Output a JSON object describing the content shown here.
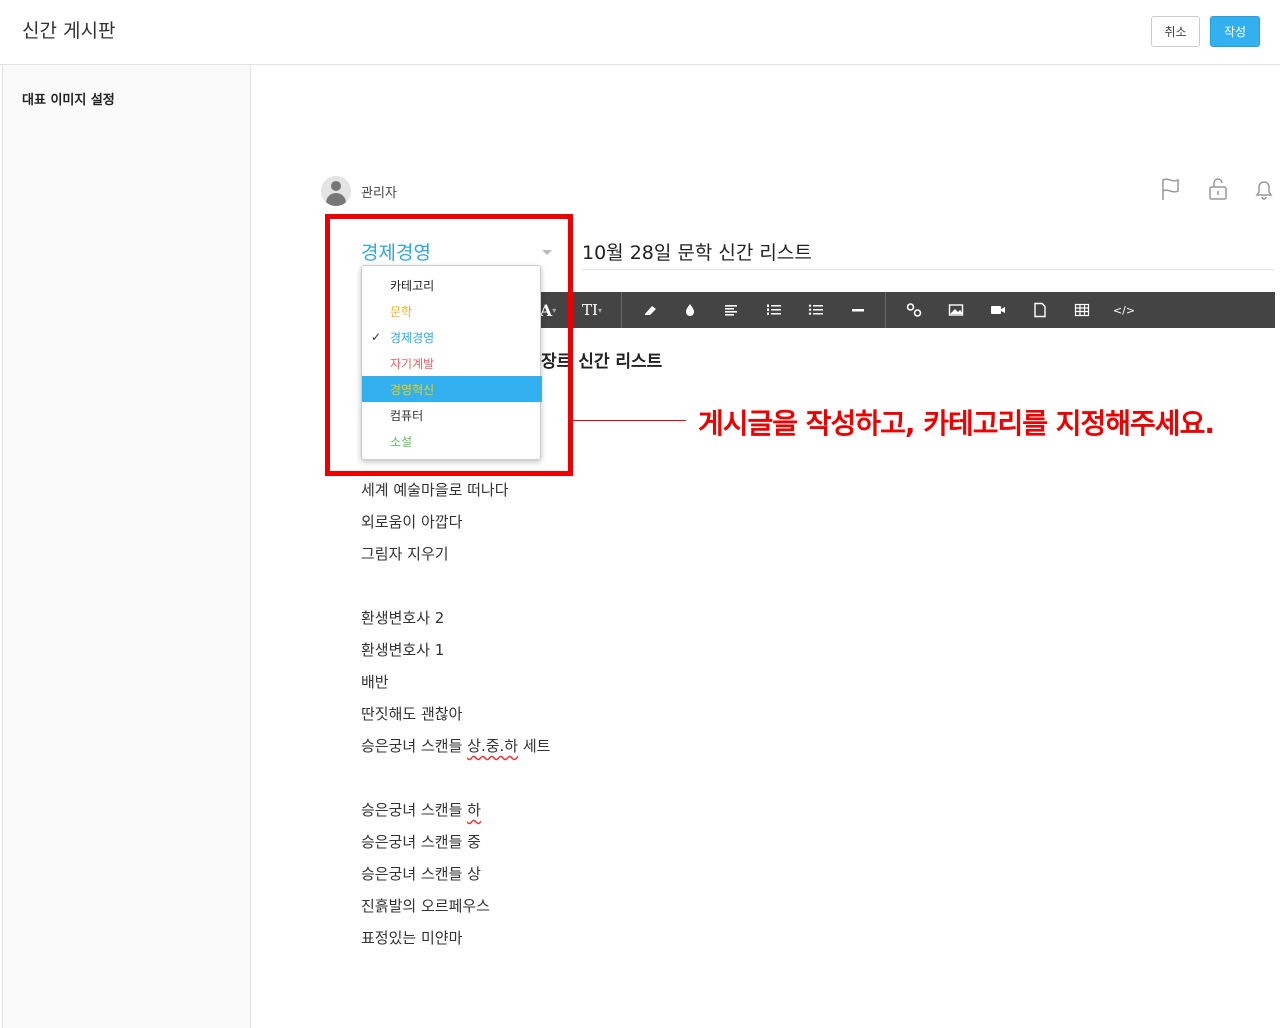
{
  "header": {
    "title": "신간 게시판",
    "cancel_label": "취소",
    "submit_label": "작성"
  },
  "sidebar": {
    "items": [
      {
        "label": "대표 이미지 설정"
      }
    ]
  },
  "post": {
    "author": "관리자",
    "category": "경제경영",
    "title": "10월 28일 문학 신간 리스트",
    "heading_partial": "장르 신간 리스트"
  },
  "category_dropdown": {
    "options": [
      {
        "label": "카테고리",
        "color": "#333333"
      },
      {
        "label": "문학",
        "color": "#f0b020"
      },
      {
        "label": "경제경영",
        "color": "#2ca8e0",
        "checked": true
      },
      {
        "label": "자기계발",
        "color": "#f06060"
      },
      {
        "label": "경영혁신",
        "color": "#f5d000",
        "highlighted": true
      },
      {
        "label": "컴퓨터",
        "color": "#333333"
      },
      {
        "label": "소설",
        "color": "#5cbf5c"
      }
    ]
  },
  "content_lines": {
    "l1": "세계 예술마을로 떠나다",
    "l2": "외로움이 아깝다",
    "l3": "그림자 지우기",
    "l4": "환생변호사 2",
    "l5": "환생변호사 1",
    "l6": "배반",
    "l7": "딴짓해도 괜찮아",
    "l8a": "승은궁녀 스캔들 ",
    "l8b": "상.중.하",
    "l8c": " 세트",
    "l9a": "승은궁녀 스캔들 ",
    "l9b": "하",
    "l10": "승은궁녀 스캔들 중",
    "l11": "승은궁녀 스캔들 상",
    "l12": "진흙발의 오르페우스",
    "l13": "표정있는 미얀마"
  },
  "annotation": {
    "callout": "게시글을 작성하고, 카테고리를 지정해주세요."
  },
  "colors": {
    "accent": "#33b0f0",
    "annotation": "#ee0000"
  }
}
